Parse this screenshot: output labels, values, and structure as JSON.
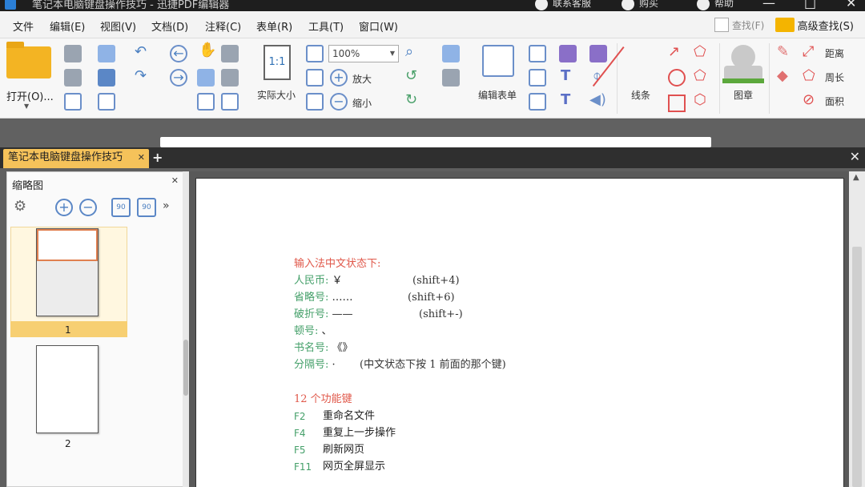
{
  "window": {
    "title": "笔记本电脑键盘操作技巧 - 迅捷PDF编辑器",
    "top_right": [
      "联系客服",
      "购买",
      "帮助"
    ]
  },
  "menu": {
    "items": [
      "文件",
      "编辑(E)",
      "视图(V)",
      "文档(D)",
      "注释(C)",
      "表单(R)",
      "工具(T)",
      "窗口(W)"
    ],
    "find_label": "查找(F)",
    "adv_find_label": "高级查找(S)"
  },
  "toolbar": {
    "open_label": "打开(O)...",
    "zoom_value": "100%",
    "actual_size_label": "实际大小",
    "zoom_in_label": "放大",
    "zoom_out_label": "缩小",
    "edit_form_label": "编辑表单",
    "lines_label": "线条",
    "stamp_label": "图章",
    "distance_label": "距离",
    "perimeter_label": "周长",
    "area_label": "面积",
    "actual_size_icon_text": "1:1"
  },
  "tabs": {
    "active_label": "笔记本电脑键盘操作技巧"
  },
  "thumb_panel": {
    "title": "缩略图",
    "pages": [
      "1",
      "2"
    ]
  },
  "document": {
    "section1_heading": "输入法中文状态下:",
    "symbols": [
      {
        "label": "人民币:",
        "value": "￥",
        "hint": "(shift+4)"
      },
      {
        "label": "省略号:",
        "value": "……",
        "hint": "(shift+6)"
      },
      {
        "label": "破折号:",
        "value": "——",
        "hint": "(shift+-)"
      },
      {
        "label": "顿号:",
        "value": "、",
        "hint": ""
      },
      {
        "label": "书名号:",
        "value": "《》",
        "hint": ""
      },
      {
        "label": "分隔号:",
        "value": "·",
        "hint": "(中文状态下按 1 前面的那个键)"
      }
    ],
    "section2_heading": "12 个功能键",
    "function_keys": [
      {
        "key": "F2",
        "desc": "重命名文件"
      },
      {
        "key": "F4",
        "desc": "重复上一步操作"
      },
      {
        "key": "F5",
        "desc": "刷新网页"
      },
      {
        "key": "F11",
        "desc": "网页全屏显示"
      }
    ]
  },
  "colors": {
    "accent": "#f5c25a",
    "heading_red": "#e0584a",
    "label_green": "#45a06a"
  }
}
